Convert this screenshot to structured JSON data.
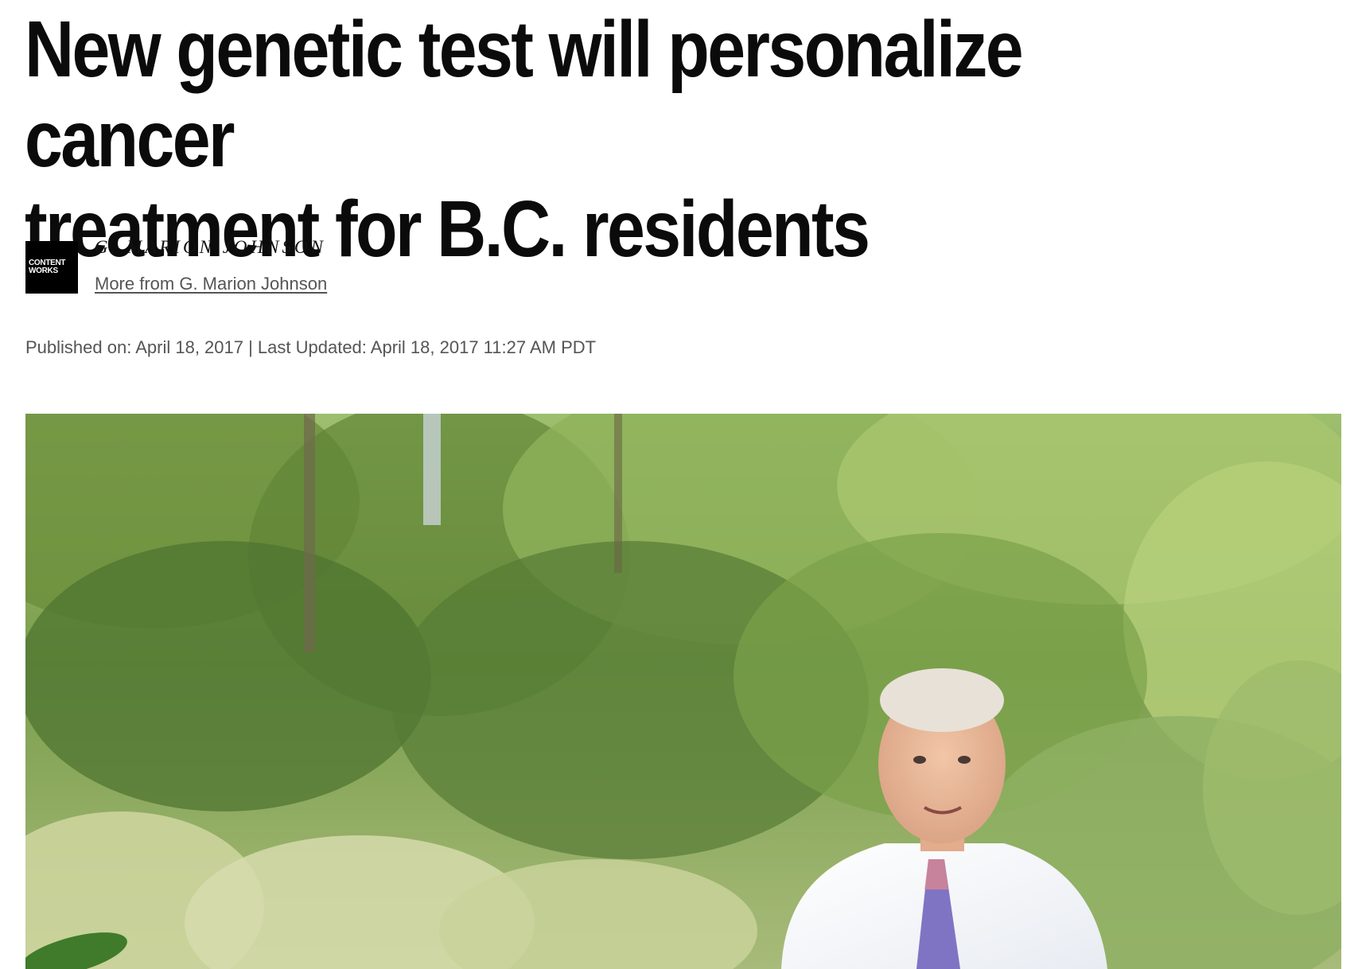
{
  "article": {
    "headline_line1": "New genetic test will personalize cancer",
    "headline_line2": "treatment for B.C. residents",
    "author": {
      "logo_line1": "CONTENT",
      "logo_line2": "WORKS",
      "name": "G. MARION JOHNSON",
      "more_link": "More from G. Marion Johnson"
    },
    "dates": "Published on: April 18, 2017 | Last Updated: April 18, 2017 11:27 AM PDT"
  },
  "colors": {
    "headline": "#0b0b0b",
    "meta_text": "#555555",
    "logo_bg": "#000000"
  }
}
